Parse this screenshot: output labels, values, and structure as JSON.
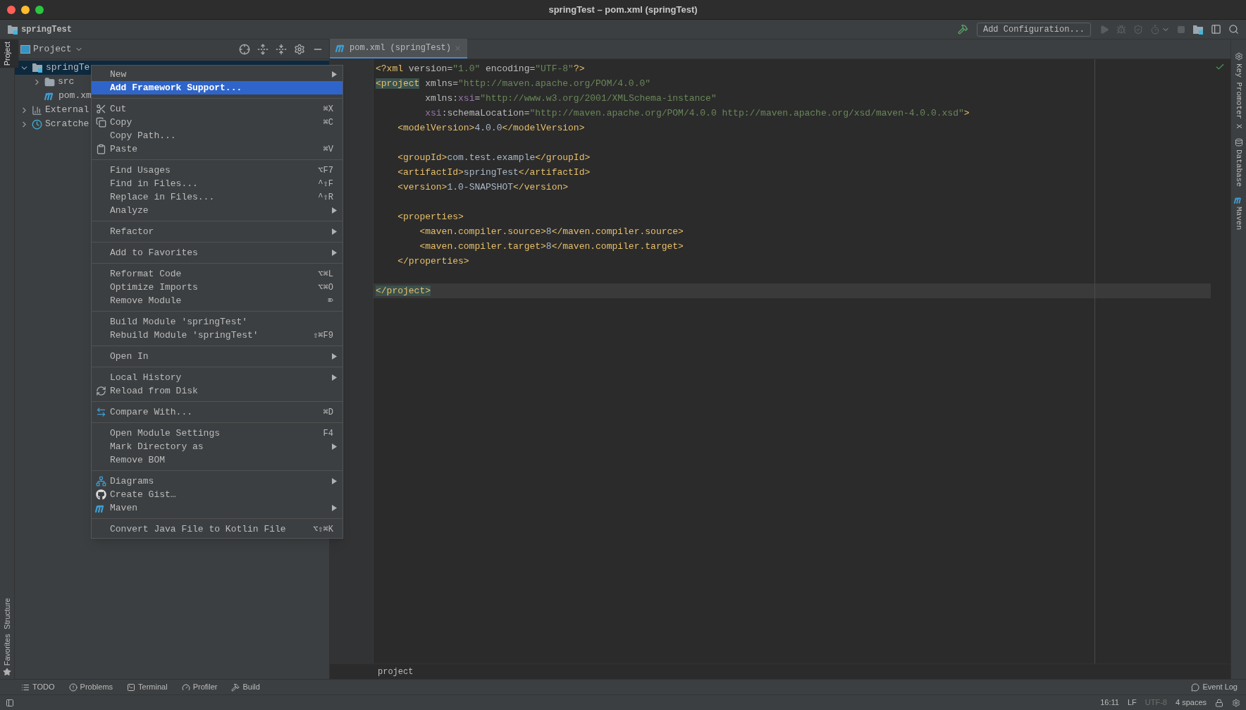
{
  "window": {
    "title": "springTest – pom.xml (springTest)"
  },
  "nav_bar": {
    "project": "springTest",
    "run_config_button": "Add Configuration..."
  },
  "left_stripe": [
    {
      "label": "Project",
      "selected": true
    },
    {
      "label": "Structure",
      "selected": false
    },
    {
      "label": "Favorites",
      "selected": false
    }
  ],
  "project_panel": {
    "title": "Project",
    "tree": [
      {
        "label": "springTe",
        "kind": "module",
        "expanded": true,
        "selected": true,
        "children": [
          {
            "label": "src",
            "kind": "folder",
            "expanded": false,
            "selected": false
          },
          {
            "label": "pom.xm",
            "kind": "maven-file",
            "selected": false
          }
        ]
      },
      {
        "label": "External",
        "kind": "libraries",
        "expanded": false,
        "selected": false
      },
      {
        "label": "Scratche",
        "kind": "scratches",
        "expanded": false,
        "selected": false
      }
    ]
  },
  "editor": {
    "tabs": [
      {
        "label": "pom.xml (springTest)",
        "selected": true
      }
    ],
    "lines": [
      {
        "current": false,
        "segments": [
          {
            "kind": "tag",
            "text": "<?xml"
          },
          {
            "kind": "attr",
            "text": " version="
          },
          {
            "kind": "value",
            "text": "\"1.0\""
          },
          {
            "kind": "attr",
            "text": " encoding="
          },
          {
            "kind": "value",
            "text": "\"UTF-8\""
          },
          {
            "kind": "tag",
            "text": "?>"
          }
        ]
      },
      {
        "current": false,
        "segments": [
          {
            "kind": "matched-tag",
            "text": "<project"
          },
          {
            "kind": "attr",
            "text": " xmlns="
          },
          {
            "kind": "value",
            "text": "\"http://maven.apache.org/POM/4.0.0\""
          }
        ]
      },
      {
        "current": false,
        "segments": [
          {
            "kind": "attr",
            "text": "         xmlns:"
          },
          {
            "kind": "ns",
            "text": "xsi"
          },
          {
            "kind": "attr",
            "text": "="
          },
          {
            "kind": "value",
            "text": "\"http://www.w3.org/2001/XMLSchema-instance\""
          }
        ]
      },
      {
        "current": false,
        "segments": [
          {
            "kind": "ns",
            "text": "         xsi"
          },
          {
            "kind": "attr",
            "text": ":schemaLocation="
          },
          {
            "kind": "value",
            "text": "\"http://maven.apache.org/POM/4.0.0 http://maven.apache.org/xsd/maven-4.0.0.xsd\""
          },
          {
            "kind": "tag",
            "text": ">"
          }
        ]
      },
      {
        "current": false,
        "segments": [
          {
            "kind": "tag",
            "text": "    <modelVersion>"
          },
          {
            "kind": "text",
            "text": "4.0.0"
          },
          {
            "kind": "tag",
            "text": "</modelVersion>"
          }
        ]
      },
      {
        "current": false
      },
      {
        "current": false,
        "segments": [
          {
            "kind": "tag",
            "text": "    <groupId>"
          },
          {
            "kind": "text",
            "text": "com.test.example"
          },
          {
            "kind": "tag",
            "text": "</groupId>"
          }
        ]
      },
      {
        "current": false,
        "segments": [
          {
            "kind": "tag",
            "text": "    <artifactId>"
          },
          {
            "kind": "text",
            "text": "springTest"
          },
          {
            "kind": "tag",
            "text": "</artifactId>"
          }
        ]
      },
      {
        "current": false,
        "segments": [
          {
            "kind": "tag",
            "text": "    <version>"
          },
          {
            "kind": "text",
            "text": "1.0-SNAPSHOT"
          },
          {
            "kind": "tag",
            "text": "</version>"
          }
        ]
      },
      {
        "current": false
      },
      {
        "current": false,
        "segments": [
          {
            "kind": "tag",
            "text": "    <properties>"
          }
        ]
      },
      {
        "current": false,
        "segments": [
          {
            "kind": "tag",
            "text": "        <maven.compiler.source>"
          },
          {
            "kind": "text",
            "text": "8"
          },
          {
            "kind": "tag",
            "text": "</maven.compiler.source>"
          }
        ]
      },
      {
        "current": false,
        "segments": [
          {
            "kind": "tag",
            "text": "        <maven.compiler.target>"
          },
          {
            "kind": "text",
            "text": "8"
          },
          {
            "kind": "tag",
            "text": "</maven.compiler.target>"
          }
        ]
      },
      {
        "current": false,
        "segments": [
          {
            "kind": "tag",
            "text": "    </properties>"
          }
        ]
      },
      {
        "current": false
      },
      {
        "current": true,
        "segments": [
          {
            "kind": "matched-tag",
            "text": "</project>"
          }
        ]
      }
    ],
    "breadcrumb": "project"
  },
  "context_menu": {
    "groups": [
      [
        {
          "label": "New",
          "submenu": true,
          "selected": false
        },
        {
          "label": "Add Framework Support...",
          "submenu": false,
          "selected": true
        }
      ],
      [
        {
          "label": "Cut",
          "shortcut": "⌘X",
          "submenu": false,
          "selected": false
        },
        {
          "label": "Copy",
          "shortcut": "⌘C",
          "submenu": false,
          "selected": false
        },
        {
          "label": "Copy Path...",
          "submenu": false,
          "selected": false
        },
        {
          "label": "Paste",
          "shortcut": "⌘V",
          "submenu": false,
          "selected": false
        }
      ],
      [
        {
          "label": "Find Usages",
          "shortcut": "⌥F7",
          "submenu": false,
          "selected": false
        },
        {
          "label": "Find in Files...",
          "shortcut": "^⇧F",
          "submenu": false,
          "selected": false
        },
        {
          "label": "Replace in Files...",
          "shortcut": "^⇧R",
          "submenu": false,
          "selected": false
        },
        {
          "label": "Analyze",
          "submenu": true,
          "selected": false
        }
      ],
      [
        {
          "label": "Refactor",
          "submenu": true,
          "selected": false
        }
      ],
      [
        {
          "label": "Add to Favorites",
          "submenu": true,
          "selected": false
        }
      ],
      [
        {
          "label": "Reformat Code",
          "shortcut": "⌥⌘L",
          "submenu": false,
          "selected": false
        },
        {
          "label": "Optimize Imports",
          "shortcut": "⌥⌘O",
          "submenu": false,
          "selected": false
        },
        {
          "label": "Remove Module",
          "shortcut": "⌦",
          "submenu": false,
          "selected": false
        }
      ],
      [
        {
          "label": "Build Module 'springTest'",
          "submenu": false,
          "selected": false
        },
        {
          "label": "Rebuild Module 'springTest'",
          "shortcut": "⇧⌘F9",
          "submenu": false,
          "selected": false
        }
      ],
      [
        {
          "label": "Open In",
          "submenu": true,
          "selected": false
        }
      ],
      [
        {
          "label": "Local History",
          "submenu": true,
          "selected": false
        },
        {
          "label": "Reload from Disk",
          "submenu": false,
          "selected": false
        }
      ],
      [
        {
          "label": "Compare With...",
          "shortcut": "⌘D",
          "submenu": false,
          "selected": false
        }
      ],
      [
        {
          "label": "Open Module Settings",
          "shortcut": "F4",
          "submenu": false,
          "selected": false
        },
        {
          "label": "Mark Directory as",
          "submenu": true,
          "selected": false
        },
        {
          "label": "Remove BOM",
          "submenu": false,
          "selected": false
        }
      ],
      [
        {
          "label": "Diagrams",
          "submenu": true,
          "selected": false
        },
        {
          "label": "Create Gist…",
          "submenu": false,
          "selected": false
        },
        {
          "label": "Maven",
          "submenu": true,
          "selected": false
        }
      ],
      [
        {
          "label": "Convert Java File to Kotlin File",
          "shortcut": "⌥⇧⌘K",
          "submenu": false,
          "selected": false
        }
      ]
    ]
  },
  "right_stripe": [
    "Key Promoter X",
    "Database",
    "Maven"
  ],
  "tool_buttons": [
    "TODO",
    "Problems",
    "Terminal",
    "Profiler",
    "Build"
  ],
  "event_log": "Event Log",
  "status_bar": [
    {
      "text": "16:11",
      "disabled": false
    },
    {
      "text": "LF",
      "disabled": false
    },
    {
      "text": "UTF-8",
      "disabled": true
    },
    {
      "text": "4 spaces",
      "disabled": false
    }
  ]
}
